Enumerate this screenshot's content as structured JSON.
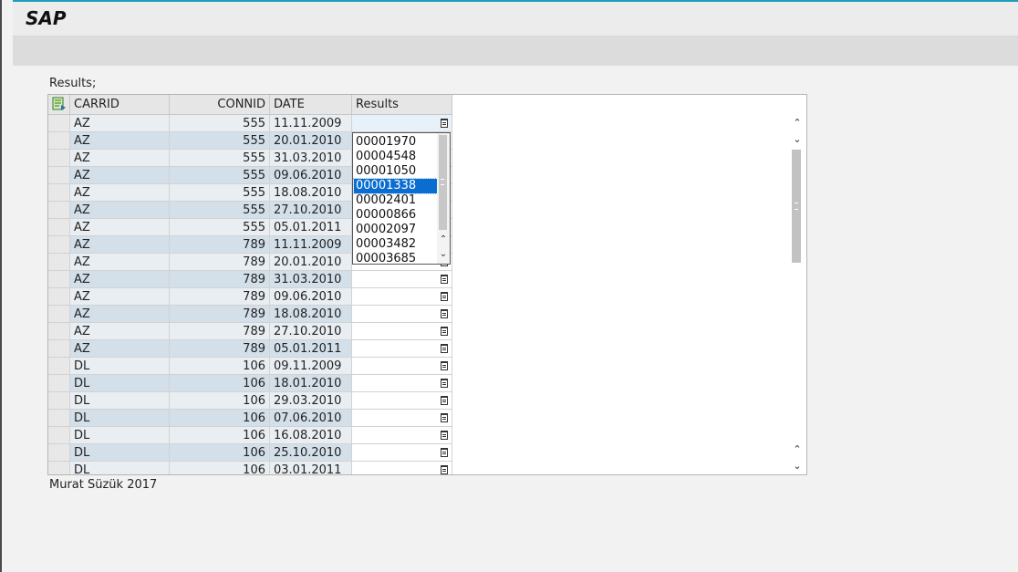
{
  "app": {
    "title": "SAP"
  },
  "caption": "Results;",
  "footer": "Murat Süzük 2017",
  "table": {
    "columns": {
      "carrid": "CARRID",
      "connid": "CONNID",
      "date": "DATE",
      "results": "Results"
    },
    "rows": [
      {
        "carrid": "AZ",
        "connid": "555",
        "date": "11.11.2009",
        "results": ""
      },
      {
        "carrid": "AZ",
        "connid": "555",
        "date": "20.01.2010",
        "results": ""
      },
      {
        "carrid": "AZ",
        "connid": "555",
        "date": "31.03.2010",
        "results": ""
      },
      {
        "carrid": "AZ",
        "connid": "555",
        "date": "09.06.2010",
        "results": ""
      },
      {
        "carrid": "AZ",
        "connid": "555",
        "date": "18.08.2010",
        "results": ""
      },
      {
        "carrid": "AZ",
        "connid": "555",
        "date": "27.10.2010",
        "results": ""
      },
      {
        "carrid": "AZ",
        "connid": "555",
        "date": "05.01.2011",
        "results": ""
      },
      {
        "carrid": "AZ",
        "connid": "789",
        "date": "11.11.2009",
        "results": ""
      },
      {
        "carrid": "AZ",
        "connid": "789",
        "date": "20.01.2010",
        "results": ""
      },
      {
        "carrid": "AZ",
        "connid": "789",
        "date": "31.03.2010",
        "results": ""
      },
      {
        "carrid": "AZ",
        "connid": "789",
        "date": "09.06.2010",
        "results": ""
      },
      {
        "carrid": "AZ",
        "connid": "789",
        "date": "18.08.2010",
        "results": ""
      },
      {
        "carrid": "AZ",
        "connid": "789",
        "date": "27.10.2010",
        "results": ""
      },
      {
        "carrid": "AZ",
        "connid": "789",
        "date": "05.01.2011",
        "results": ""
      },
      {
        "carrid": "DL",
        "connid": "106",
        "date": "09.11.2009",
        "results": ""
      },
      {
        "carrid": "DL",
        "connid": "106",
        "date": "18.01.2010",
        "results": ""
      },
      {
        "carrid": "DL",
        "connid": "106",
        "date": "29.03.2010",
        "results": ""
      },
      {
        "carrid": "DL",
        "connid": "106",
        "date": "07.06.2010",
        "results": ""
      },
      {
        "carrid": "DL",
        "connid": "106",
        "date": "16.08.2010",
        "results": ""
      },
      {
        "carrid": "DL",
        "connid": "106",
        "date": "25.10.2010",
        "results": ""
      },
      {
        "carrid": "DL",
        "connid": "106",
        "date": "03.01.2011",
        "results": ""
      }
    ]
  },
  "dropdown": {
    "items": [
      "00001970",
      "00004548",
      "00001050",
      "00001338",
      "00002401",
      "00000866",
      "00002097",
      "00003482",
      "00003685"
    ],
    "selected": "00001338"
  },
  "icons": {
    "select_all": "select-all-icon",
    "value_help": "value-help-icon",
    "scroll_up": "chevron-up-icon",
    "scroll_down": "chevron-down-icon"
  },
  "colors": {
    "accent": "#1f9cb8",
    "row_light": "#e9eef2",
    "row_dark": "#d3dfe9",
    "selection": "#0a6ed1"
  }
}
